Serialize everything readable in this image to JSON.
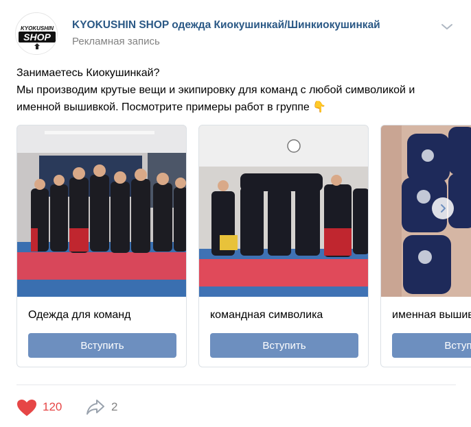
{
  "post": {
    "author": "KYOKUSHIN SHOP одежда Киокушинкай/Шинкиокушинкай",
    "subtitle": "Рекламная запись",
    "avatar_text_top": "KYOKUSHIN",
    "avatar_text_main": "SHOP",
    "text_lines": [
      "Занимаетесь Киокушинкай?",
      "Мы производим крутые вещи и экипировку для команд с любой символикой и",
      "именной вышивкой. Посмотрите примеры работ в группе 👇"
    ]
  },
  "carousel": {
    "cards": [
      {
        "title": "Одежда для команд",
        "button": "Вступить"
      },
      {
        "title": "командная символика",
        "button": "Вступить"
      },
      {
        "title": "именная вышивка",
        "button": "Вступить"
      }
    ]
  },
  "actions": {
    "likes": "120",
    "shares": "2"
  },
  "colors": {
    "link": "#2a5885",
    "button": "#6d8fbf",
    "like": "#e64646",
    "muted": "#828282"
  }
}
